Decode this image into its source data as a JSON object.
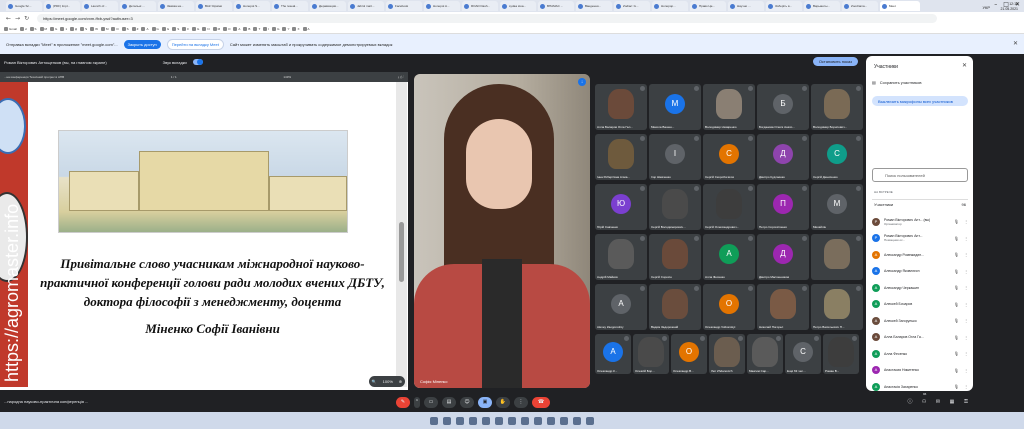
{
  "browser": {
    "tabs": [
      "Google Sc...",
      "(PDF) Impl...",
      "Launch of...",
      "Детальні ...",
      "Заявка на...",
      "ВАК України",
      "Honepot S...",
      "The reseal...",
      "Деравиация...",
      "Jabrol mart...",
      "Facebook",
      "Honepot A...",
      "ROAD Dash...",
      "sydaa stua...",
      "ВПАМАС ...",
      "Введення...",
      "Zodiac: G...",
      "Honepop...",
      "Право Це...",
      "Научно ...",
      "Зоберіть в...",
      "Варыанты...",
      "Zoodrama...",
      "Meet"
    ],
    "url": "https://meet.google.com/vxm-ffxb-ywd?authuser=3",
    "window_controls": [
      "–",
      "□",
      "✕"
    ],
    "bookmarks": [
      "Gmail",
      "d",
      "S",
      "M",
      "G",
      "1",
      "Д",
      "S",
      "W",
      "M",
      "D",
      "S",
      "Z",
      "A",
      "G",
      "G",
      "S",
      "F",
      "G",
      "N",
      "M",
      "O",
      "A",
      "B",
      "T",
      "I",
      "G",
      "Y",
      "X",
      "A"
    ],
    "info_text": "Отправка вкладки \"Meet\" в приложение \"meet.google.com\"...",
    "info_btn_primary": "Закрыть доступ",
    "info_btn_secondary": "Перейти на вкладку Meet",
    "info_note": "Сайт может изменять масштаб и прокручивать содержимое демонстрируемых вкладок"
  },
  "meet": {
    "presenter_label": "Роман Вікторович Антощенков (вы, на главном экране)",
    "share_sound": "Звук вкладки",
    "stop_show": "Остановить показ",
    "share_header_left": "...на конференція Технічний прогрес в АПВ",
    "share_header_mid": "1 / 1",
    "share_header_zoom": "143%",
    "zoom_badge": "100%",
    "slide": {
      "vertical_text": "https://agromaster.info",
      "paragraph1": "Привітальне слово учасникам міжнародної науково-практичної конференції голови ради молодих вчених ДБТУ, доктора філософії з менеджменту, доцента",
      "paragraph2": "Міненко Софії Іванівни"
    },
    "speaker_name": "Софія Міненко",
    "bottom_title": "...народна науково-практична конференція ...",
    "participant_count": "96"
  },
  "grid_tiles": [
    {
      "name": "Алла Баларов Огла Гал...",
      "letter": "",
      "color": "#6b4a3a"
    },
    {
      "name": "Микола Вашен...",
      "letter": "М",
      "color": "#1a73e8"
    },
    {
      "name": "Володимир Назаренко",
      "letter": "",
      "color": "#8a7f73"
    },
    {
      "name": "Богданова Олеся Анато...",
      "letter": "Б",
      "color": "#5f6368"
    },
    {
      "name": "Володимир Борисович...",
      "letter": "",
      "color": "#7a6a55"
    },
    {
      "name": "Інна Робертівна Алма...",
      "letter": "",
      "color": "#6e5a3d"
    },
    {
      "name": "Ігор Шевченко",
      "letter": "І",
      "color": "#5f6368"
    },
    {
      "name": "Сергій Скоробогатов",
      "letter": "С",
      "color": "#e37400"
    },
    {
      "name": "Дмитро Кудлаєнко",
      "letter": "Д",
      "color": "#8e44ad"
    },
    {
      "name": "Сергій Денисенко",
      "letter": "С",
      "color": "#0f9d8a"
    },
    {
      "name": "Юрій Савченко",
      "letter": "Ю",
      "color": "#7b3fd0"
    },
    {
      "name": "Сергій Володимирович...",
      "letter": "",
      "color": "#4a4a4a"
    },
    {
      "name": "Сергій Олександрович...",
      "letter": "",
      "color": "#3d3d3d"
    },
    {
      "name": "Петро Сорохіспенко",
      "letter": "П",
      "color": "#9c27b0"
    },
    {
      "name": "Михайлін",
      "letter": "М",
      "color": "#5f6368"
    },
    {
      "name": "Андрій Майков",
      "letter": "",
      "color": "#5a5a5a"
    },
    {
      "name": "Сергій Сорохін",
      "letter": "",
      "color": "#6a4a3a"
    },
    {
      "name": "Алла Фесенко",
      "letter": "А",
      "color": "#0f9d58"
    },
    {
      "name": "Дмитро Масленников",
      "letter": "Д",
      "color": "#9c27b0"
    },
    {
      "name": "",
      "letter": "",
      "color": "#7a6d5c"
    },
    {
      "name": "Alexey Zaogorodniy",
      "letter": "A",
      "color": "#5f6368"
    },
    {
      "name": "Вадим Задорожний",
      "letter": "",
      "color": "#6a4d3d"
    },
    {
      "name": "Олександр Volkonskyi",
      "letter": "О",
      "color": "#e37400"
    },
    {
      "name": "Николай Погорел",
      "letter": "",
      "color": "#7a5a45"
    },
    {
      "name": "Петро Васильович П...",
      "letter": "",
      "color": "#8a7f63"
    },
    {
      "name": "Олександр К...",
      "letter": "А",
      "color": "#1a73e8"
    },
    {
      "name": "Олексій Бор...",
      "letter": "",
      "color": "#4a4a4a"
    },
    {
      "name": "Олександр В...",
      "letter": "О",
      "color": "#e37400"
    },
    {
      "name": "Ihor Zhdanovich",
      "letter": "",
      "color": "#6b5d4f"
    },
    {
      "name": "Максим Сар...",
      "letter": "",
      "color": "#5a5a5a"
    },
    {
      "name": "Ещё 63 чел...",
      "letter": "С",
      "color": "#5f6368"
    },
    {
      "name": "Роман В...",
      "letter": "",
      "color": "#3d3d3d"
    }
  ],
  "panel": {
    "title": "Участники",
    "save_label": "Сохранить участников",
    "mute_label": "Выключить микрофоны всех участников",
    "search_placeholder": "Поиск пользователей",
    "section_label": "НА ВСТРЕЧЕ",
    "list_header": "Участники",
    "list_count": "96",
    "people": [
      {
        "name": "Роман Вікторович Ант... (вы)",
        "role": "Организатор",
        "color": "#6b4a3a",
        "letter": "Р"
      },
      {
        "name": "Роман Вікторович Ант...",
        "role": "Помощник ос...",
        "color": "#1a73e8",
        "letter": "Р"
      },
      {
        "name": "Александр Ромежидин...",
        "role": "",
        "color": "#e37400",
        "letter": "А"
      },
      {
        "name": "Александр Яковлєєсп",
        "role": "",
        "color": "#1a73e8",
        "letter": "А"
      },
      {
        "name": "Александр Черкашин",
        "role": "",
        "color": "#0f9d58",
        "letter": "А"
      },
      {
        "name": "Алексей Бочаров",
        "role": "",
        "color": "#0f9d58",
        "letter": "А"
      },
      {
        "name": "Алексей Загорулько",
        "role": "",
        "color": "#6a4d3d",
        "letter": "А"
      },
      {
        "name": "Алла Баларов Огла Га...",
        "role": "",
        "color": "#6b4a3a",
        "letter": "А"
      },
      {
        "name": "Алла Фесенко",
        "role": "",
        "color": "#0f9d58",
        "letter": "А"
      },
      {
        "name": "Анастасия Никитенко",
        "role": "",
        "color": "#9c27b0",
        "letter": "А"
      },
      {
        "name": "Анастасія Захаренко",
        "role": "",
        "color": "#0f9d58",
        "letter": "А"
      },
      {
        "name": "Анатолій Автухов",
        "role": "",
        "color": "#e37400",
        "letter": "А"
      },
      {
        "name": "Анатолій Дмитрович...",
        "role": "",
        "color": "#5f6368",
        "letter": "А"
      },
      {
        "name": "Анатолий Миколайович...",
        "role": "",
        "color": "#8a7f73",
        "letter": "А"
      }
    ]
  },
  "taskbar": {
    "time": "12:14",
    "date": "21.05.2021",
    "lang": "УКР"
  }
}
